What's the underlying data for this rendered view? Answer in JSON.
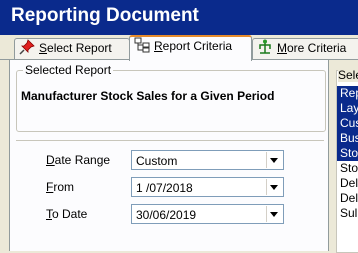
{
  "window": {
    "title": "Reporting Document"
  },
  "tabs": [
    {
      "label": "Select Report",
      "underline": "S",
      "rest": "elect Report"
    },
    {
      "label": "Report Criteria",
      "underline": "R",
      "rest": "eport Criteria"
    },
    {
      "label": "More Criteria",
      "underline": "M",
      "rest": "ore Criteria"
    }
  ],
  "selected_report": {
    "legend": "Selected Report",
    "name": "Manufacturer Stock Sales for a Given Period"
  },
  "criteria": {
    "date_range": {
      "label": "Date Range",
      "underline": "D",
      "rest": "ate Range",
      "value": "Custom"
    },
    "from": {
      "label": "From",
      "underline": "F",
      "rest": "rom",
      "value": "1 /07/2018"
    },
    "to_date": {
      "label": "To Date",
      "underline": "T",
      "rest": "o Date",
      "value": "30/06/2019"
    }
  },
  "right_panel": {
    "legend": "Sele",
    "items": [
      {
        "text": "Rep",
        "selected": true
      },
      {
        "text": "Lay",
        "selected": true
      },
      {
        "text": "Cus",
        "selected": true
      },
      {
        "text": "Bus",
        "selected": true
      },
      {
        "text": "Sto",
        "selected": true
      },
      {
        "text": "Sto",
        "selected": false
      },
      {
        "text": "Del",
        "selected": false
      },
      {
        "text": "Del",
        "selected": false
      },
      {
        "text": "Sul",
        "selected": false
      }
    ]
  },
  "colors": {
    "title_bar": "#0a2a8c",
    "selection": "#0a2a8c",
    "tab_highlight": "#e68b2c"
  }
}
